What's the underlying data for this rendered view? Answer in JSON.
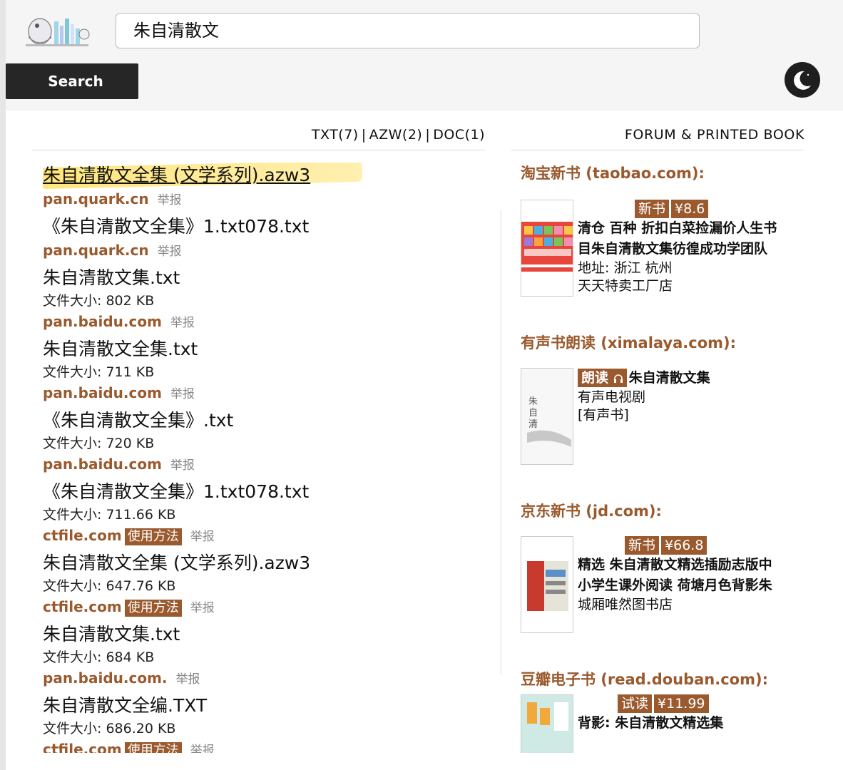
{
  "search": {
    "query": "朱自清散文",
    "button_label": "Search"
  },
  "filters": [
    {
      "label": "TXT(7)"
    },
    {
      "label": "AZW(2)"
    },
    {
      "label": "DOC(1)"
    }
  ],
  "forum_title": "FORUM & PRINTED BOOK",
  "report_label": "举报",
  "use_label": "使用方法",
  "size_prefix": "文件大小: ",
  "results": [
    {
      "title": "朱自清散文全集 (文学系列).azw3",
      "domain": "pan.quark.cn"
    },
    {
      "title": "《朱自清散文全集》1.txt078.txt",
      "domain": "pan.quark.cn"
    },
    {
      "title": "朱自清散文集.txt",
      "size": "802 KB",
      "domain": "pan.baidu.com"
    },
    {
      "title": "朱自清散文全集.txt",
      "size": "711 KB",
      "domain": "pan.baidu.com"
    },
    {
      "title": "《朱自清散文全集》.txt",
      "size": "720 KB",
      "domain": "pan.baidu.com"
    },
    {
      "title": "《朱自清散文全集》1.txt078.txt",
      "size": "711.66 KB",
      "domain": "ctfile.com"
    },
    {
      "title": "朱自清散文全集 (文学系列).azw3",
      "size": "647.76 KB",
      "domain": "ctfile.com"
    },
    {
      "title": "朱自清散文集.txt",
      "size": "684 KB",
      "domain": "pan.baidu.com."
    },
    {
      "title": "朱自清散文全编.TXT",
      "size": "686.20 KB",
      "domain": "ctfile.com"
    }
  ],
  "shops": [
    {
      "heading": "淘宝新书 (taobao.com):",
      "badge1": "新书",
      "badge2": "¥8.6",
      "line1": "清仓 百种 折扣白菜捡漏价人生书",
      "line2": "目朱自清散文集彷徨成功学团队",
      "line3": "地址: 浙江 杭州",
      "line4": "天天特卖工厂店"
    },
    {
      "heading": "有声书朗读 (ximalaya.com):",
      "badge1": "朗读",
      "title": "朱自清散文集",
      "line1": "有声电视剧",
      "line2": "[有声书]"
    },
    {
      "heading": "京东新书 (jd.com):",
      "badge1": "新书",
      "badge2": "¥66.8",
      "line1": "精选 朱自清散文精选插励志版中",
      "line2": "小学生课外阅读 荷塘月色背影朱",
      "line3": "城厢唯然图书店"
    },
    {
      "heading": "豆瓣电子书 (read.douban.com):",
      "badge1": "试读",
      "badge2": "¥11.99",
      "line1": "背影: 朱自清散文精选集"
    }
  ]
}
